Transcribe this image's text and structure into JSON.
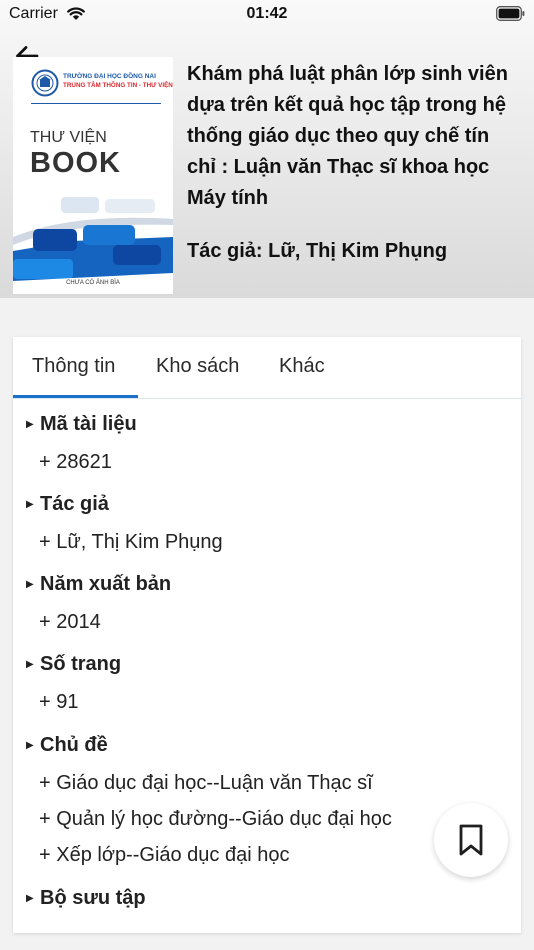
{
  "status": {
    "carrier": "Carrier",
    "time": "01:42"
  },
  "cover": {
    "school": "TRƯỜNG ĐẠI HỌC ĐỒNG NAI",
    "center": "TRUNG TÂM THÔNG TIN - THƯ VIỆN",
    "library_label": "THƯ VIỆN",
    "book_label": "BOOK",
    "no_image": "CHƯA CÓ ẢNH BÌA"
  },
  "book": {
    "title": "Khám phá luật phân lớp sinh viên dựa trên kết quả học tập trong hệ thống giáo dục theo quy chế tín chỉ : Luận văn Thạc sĩ khoa học Máy tính",
    "author": "Tác giả: Lữ, Thị Kim Phụng"
  },
  "tabs": [
    {
      "label": "Thông tin"
    },
    {
      "label": "Kho sách"
    },
    {
      "label": "Khác"
    }
  ],
  "info": {
    "sections": [
      {
        "title": "Mã tài liệu",
        "items": [
          "+ 28621"
        ]
      },
      {
        "title": "Tác giả",
        "items": [
          "+ Lữ, Thị Kim Phụng"
        ]
      },
      {
        "title": "Năm xuất bản",
        "items": [
          "+ 2014"
        ]
      },
      {
        "title": "Số trang",
        "items": [
          "+ 91"
        ]
      },
      {
        "title": "Chủ đề",
        "items": [
          "+ Giáo dục đại  học--Luận văn Thạc sĩ",
          "+ Quản lý học đường--Giáo dục đại học",
          "+ Xếp lớp--Giáo dục đại học"
        ]
      },
      {
        "title": "Bộ sưu tập",
        "items": []
      }
    ]
  },
  "colors": {
    "accent": "#1a73c8",
    "cover_blue": "#1565c0"
  }
}
